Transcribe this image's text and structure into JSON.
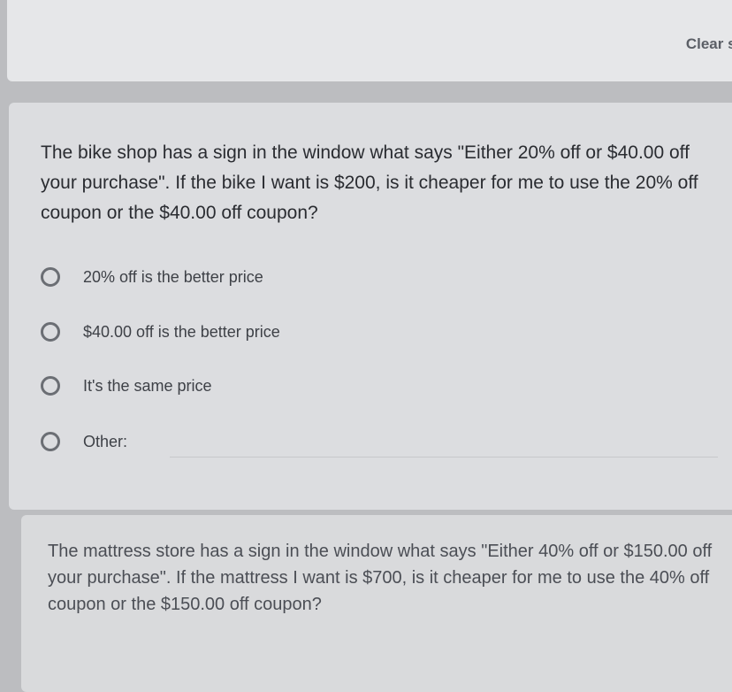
{
  "toolbar": {
    "clear_label": "Clear se"
  },
  "question1": {
    "title": "The bike shop has a sign in the window what says \"Either 20% off or $40.00 off your purchase\". If the bike I want is $200, is it cheaper for me to use the 20% off coupon or the $40.00 off coupon?",
    "options": [
      {
        "label": "20% off is the better price"
      },
      {
        "label": "$40.00 off is the better price"
      },
      {
        "label": "It's the same price"
      },
      {
        "label": "Other:"
      }
    ]
  },
  "question2": {
    "title": "The mattress store has a sign in the window what says \"Either 40% off or $150.00 off your purchase\". If the mattress I want is $700, is it cheaper for me to use the 40% off coupon or the $150.00 off coupon?"
  }
}
